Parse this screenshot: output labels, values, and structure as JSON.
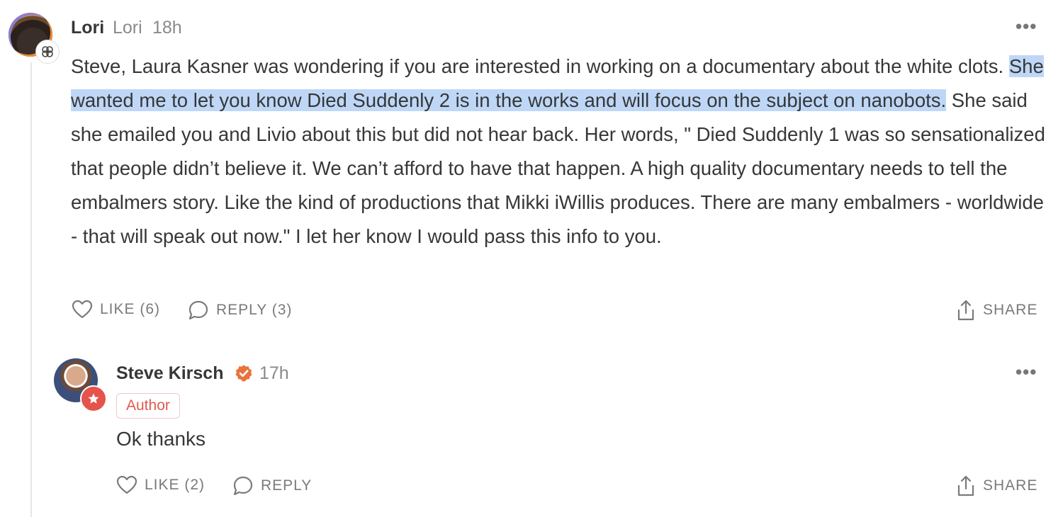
{
  "comment": {
    "author_name": "Lori",
    "author_handle": "Lori",
    "time": "18h",
    "menu_icon": "more-dots-icon",
    "text_before": "Steve, Laura Kasner was wondering if you are interested in working on a documentary about the white clots. ",
    "text_highlighted": "She wanted me to let you know Died Suddenly 2 is in the works and will focus on the subject on nanobots.",
    "text_after": " She said she emailed you and Livio about this but did not hear back. Her words, \" Died Suddenly 1 was so sensationalized that people didn’t believe it. We can’t afford to have that happen. A high quality documentary needs to tell the embalmers story. Like the kind of productions that Mikki iWillis produces. There are many embalmers - worldwide - that will speak out now.\" I let her know I would pass this info to you.",
    "like_label": "LIKE (6)",
    "reply_label": "REPLY (3)",
    "share_label": "SHARE"
  },
  "reply": {
    "author_name": "Steve Kirsch",
    "time": "17h",
    "badge": "Author",
    "text": "Ok thanks",
    "like_label": "LIKE (2)",
    "reply_label": "REPLY",
    "share_label": "SHARE"
  },
  "colors": {
    "highlight": "#bfd7f7",
    "verified": "#e8743b",
    "author_badge": "#e05a52"
  }
}
